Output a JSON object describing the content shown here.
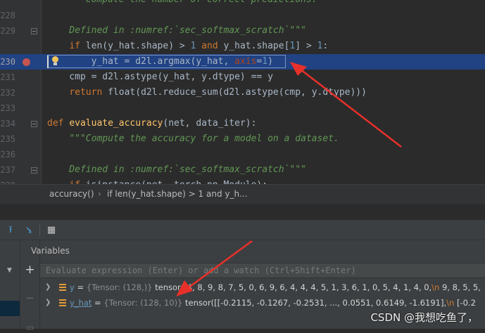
{
  "editor": {
    "lines": [
      {
        "num": "",
        "tokens": [
          {
            "t": "    \"\"\"Compute the number of correct predictions.",
            "c": "doc"
          }
        ]
      },
      {
        "num": "228",
        "tokens": []
      },
      {
        "num": "229",
        "tokens": [
          {
            "t": "    Defined in :numref:`sec_softmax_scratch`\"\"\"",
            "c": "doc"
          }
        ]
      },
      {
        "num": "",
        "tokens": [
          {
            "t": "    ",
            "c": ""
          },
          {
            "t": "if ",
            "c": "kw"
          },
          {
            "t": "len(y_hat.shape) > ",
            "c": ""
          },
          {
            "t": "1 ",
            "c": "num"
          },
          {
            "t": "and ",
            "c": "kw"
          },
          {
            "t": "y_hat.shape[",
            "c": ""
          },
          {
            "t": "1",
            "c": "num"
          },
          {
            "t": "] > ",
            "c": ""
          },
          {
            "t": "1",
            "c": "num"
          },
          {
            "t": ":",
            "c": ""
          }
        ]
      },
      {
        "num": "230",
        "tokens": [
          {
            "t": "        y_hat = d2l.argmax(y_hat, ",
            "c": ""
          },
          {
            "t": "axis",
            "c": "param"
          },
          {
            "t": "=",
            "c": ""
          },
          {
            "t": "1",
            "c": "num"
          },
          {
            "t": ")",
            "c": ""
          }
        ]
      },
      {
        "num": "231",
        "tokens": [
          {
            "t": "    cmp = d2l.astype(y_hat, y.dtype) == y",
            "c": ""
          }
        ]
      },
      {
        "num": "232",
        "tokens": [
          {
            "t": "    ",
            "c": ""
          },
          {
            "t": "return ",
            "c": "kw"
          },
          {
            "t": "float(d2l.reduce_sum(d2l.astype(cmp, y.dtype)))",
            "c": ""
          }
        ]
      },
      {
        "num": "233",
        "tokens": []
      },
      {
        "num": "234",
        "tokens": [
          {
            "t": "def ",
            "c": "kw"
          },
          {
            "t": "evaluate_accuracy",
            "c": "fn"
          },
          {
            "t": "(net, data_iter):",
            "c": ""
          }
        ]
      },
      {
        "num": "235",
        "tokens": [
          {
            "t": "    \"\"\"Compute the accuracy for a model on a dataset.",
            "c": "doc"
          }
        ]
      },
      {
        "num": "236",
        "tokens": []
      },
      {
        "num": "237",
        "tokens": [
          {
            "t": "    Defined in :numref:`sec_softmax_scratch`\"\"\"",
            "c": "doc"
          }
        ]
      },
      {
        "num": "238",
        "tokens": [
          {
            "t": "    ",
            "c": ""
          },
          {
            "t": "if ",
            "c": "kw"
          },
          {
            "t": "isinstance(net, torch.nn.Module):",
            "c": ""
          }
        ]
      }
    ]
  },
  "breadcrumb": {
    "item1": "accuracy()",
    "separator": "›",
    "item2": "if len(y_hat.shape) > 1 and y_h..."
  },
  "debug": {
    "variables_header": "Variables",
    "eval_placeholder": "Evaluate expression (Enter) or add a watch (Ctrl+Shift+Enter)",
    "variables": [
      {
        "name": "y",
        "eq": " = ",
        "type": "{Tensor: (128,)}",
        "value": " tensor([4, 8, 9, 8, 7, 5, 0, 6, 9, 6, 4, 4, 4, 5, 1, 3, 6, 1, 0, 5, 4, 1, 4, 0,",
        "nl": "\\n",
        "tail": "        9, 8, 5, 5,"
      },
      {
        "name": "y_hat",
        "eq": " = ",
        "type": "{Tensor: (128, 10)}",
        "value": " tensor([[-0.2115, -0.1267, -0.2531,  ...,  0.0551,  0.6149, -1.6191],",
        "nl": "\\n",
        "tail": "        [-0.2"
      }
    ]
  },
  "watermark": "CSDN @我想吃鱼了，",
  "colors": {
    "arrow": "#e8302a",
    "selection": "#214283",
    "breakpoint": "#c75450"
  }
}
